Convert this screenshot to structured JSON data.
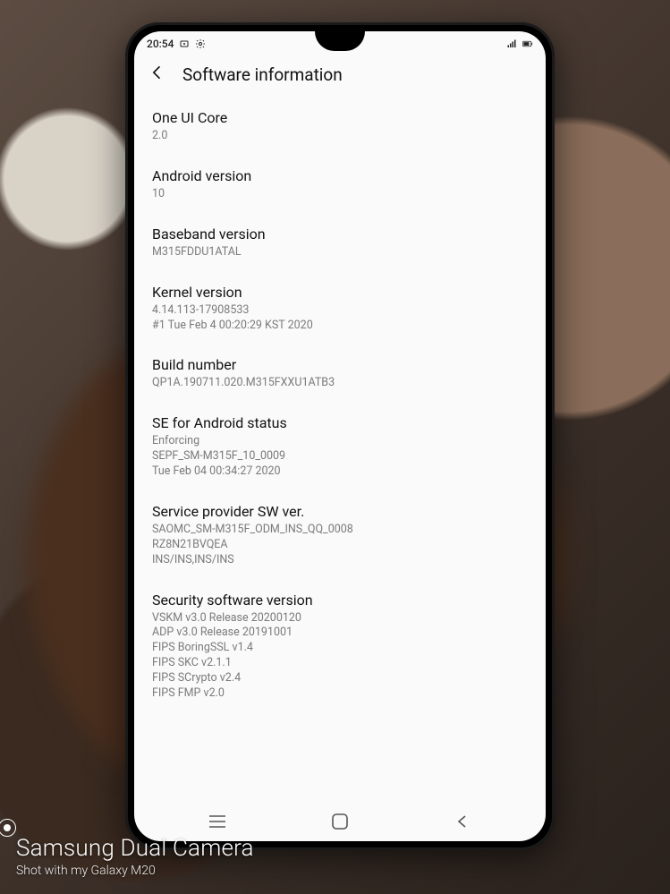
{
  "status": {
    "time": "20:54"
  },
  "header": {
    "title": "Software information"
  },
  "items": [
    {
      "title": "One UI Core",
      "value": "2.0"
    },
    {
      "title": "Android version",
      "value": "10"
    },
    {
      "title": "Baseband version",
      "value": "M315FDDU1ATAL"
    },
    {
      "title": "Kernel version",
      "value": "4.14.113-17908533\n#1 Tue Feb 4 00:20:29 KST 2020"
    },
    {
      "title": "Build number",
      "value": "QP1A.190711.020.M315FXXU1ATB3"
    },
    {
      "title": "SE for Android status",
      "value": "Enforcing\nSEPF_SM-M315F_10_0009\nTue Feb 04 00:34:27 2020"
    },
    {
      "title": "Service provider SW ver.",
      "value": "SAOMC_SM-M315F_ODM_INS_QQ_0008\nRZ8N21BVQEA\nINS/INS,INS/INS"
    },
    {
      "title": "Security software version",
      "value": "VSKM v3.0 Release 20200120\nADP v3.0 Release 20191001\nFIPS BoringSSL v1.4\nFIPS SKC v2.1.1\nFIPS SCrypto v2.4\nFIPS FMP v2.0"
    }
  ],
  "watermark": {
    "line1": "Samsung Dual Camera",
    "line2": "Shot with my Galaxy M20"
  }
}
